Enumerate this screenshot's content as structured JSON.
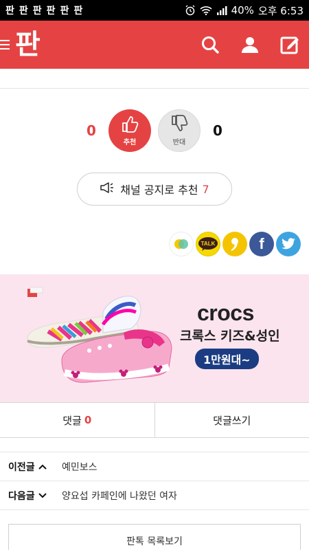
{
  "status_bar": {
    "notifications": [
      "판",
      "판",
      "판",
      "판",
      "판",
      "판"
    ],
    "battery": "40%",
    "time": "오후 6:53"
  },
  "header": {
    "logo": "판",
    "icons": [
      "menu-icon",
      "search-icon",
      "user-icon",
      "write-icon"
    ]
  },
  "vote": {
    "up_count": "0",
    "up_label": "추천",
    "down_label": "반대",
    "down_count": "0"
  },
  "notice": {
    "label": "채널 공지로 추천",
    "count": "7"
  },
  "share": {
    "items": [
      "kakaostory",
      "kakaotalk",
      "band",
      "facebook",
      "twitter"
    ],
    "talk_label": "TALK",
    "fb_label": "f"
  },
  "ad": {
    "brand": "crocs",
    "subtitle": "크록스 키즈&성인",
    "price": "1만원대~",
    "background": "#fbe4ee"
  },
  "comments": {
    "comments_label": "댓글",
    "comments_count": "0",
    "write_label": "댓글쓰기"
  },
  "nav": {
    "prev_label": "이전글",
    "prev_title": "예민보스",
    "next_label": "다음글",
    "next_title": "양요섭 카페인에 나왔던 여자"
  },
  "list_button": "판톡 목록보기",
  "colors": {
    "brand_red": "#e54343",
    "facebook": "#3b5998",
    "twitter": "#3ea4e0",
    "kakao": "#f5d900"
  }
}
